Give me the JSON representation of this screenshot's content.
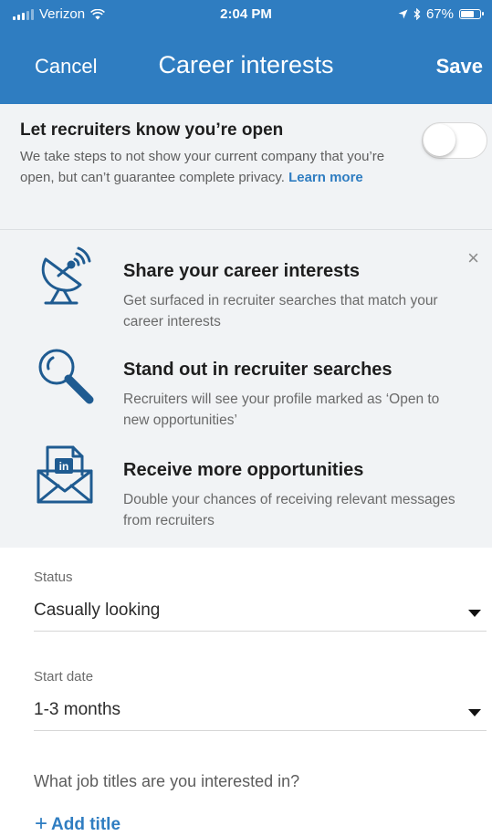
{
  "status_bar": {
    "carrier": "Verizon",
    "time": "2:04 PM",
    "battery": "67%"
  },
  "nav": {
    "cancel": "Cancel",
    "title": "Career interests",
    "save": "Save"
  },
  "recruiter_toggle": {
    "title": "Let recruiters know you’re open",
    "description": "We take steps to not show your current company that you’re open, but can’t guarantee complete privacy.",
    "link": "Learn more",
    "enabled": false
  },
  "features": {
    "close": "×",
    "items": [
      {
        "icon": "satellite-dish-icon",
        "title": "Share your career interests",
        "description": "Get surfaced in recruiter searches that match your career interests"
      },
      {
        "icon": "magnifier-icon",
        "title": "Stand out in recruiter searches",
        "description": "Recruiters will see your profile marked as ‘Open to new opportunities’"
      },
      {
        "icon": "linkedin-envelope-icon",
        "title": "Receive more opportunities",
        "description": "Double your chances of receiving relevant messages from recruiters"
      }
    ]
  },
  "status_field": {
    "label": "Status",
    "value": "Casually looking"
  },
  "start_date_field": {
    "label": "Start date",
    "value": "1-3 months"
  },
  "job_titles": {
    "question": "What job titles are you interested in?",
    "add": "Add title",
    "add_icon": "+"
  },
  "colors": {
    "brand_blue": "#2f7dc1",
    "icon_blue": "#1f5b91",
    "panel_gray": "#f1f3f5"
  }
}
